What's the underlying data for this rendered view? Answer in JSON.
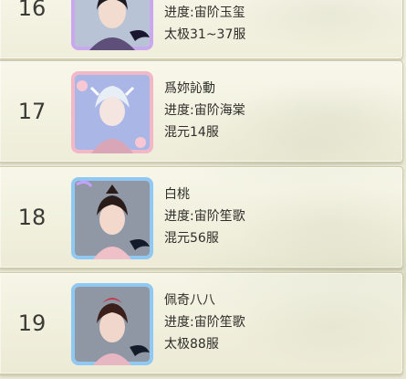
{
  "rows": [
    {
      "rank": "16",
      "name": "",
      "stage": "进度:宙阶玉玺",
      "power": "太极31~37服",
      "frame": "lavender",
      "bg": "#b9c3d6"
    },
    {
      "rank": "17",
      "name": "爲妳訫動",
      "stage": "进度:宙阶海棠",
      "power": "混元14服",
      "frame": "pink",
      "bg": "#a9b6e6"
    },
    {
      "rank": "18",
      "name": "白桃",
      "stage": "进度:宙阶笙歌",
      "power": "混元56服",
      "frame": "blue",
      "bg": "#8f98a4"
    },
    {
      "rank": "19",
      "name": "佩奇八八",
      "stage": "进度:宙阶笙歌",
      "power": "太极88服",
      "frame": "blue",
      "bg": "#8e97a3"
    }
  ],
  "colors": {
    "lavender": "#c9a8ee",
    "pink": "#f3b8c8",
    "blue": "#8fc8f2"
  }
}
